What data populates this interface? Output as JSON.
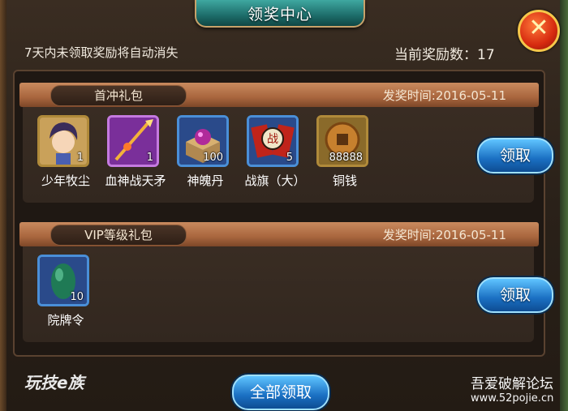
{
  "window": {
    "title": "领奖中心"
  },
  "header": {
    "notice": "7天内未领取奖励将自动消失",
    "reward_count": "当前奖励数：17"
  },
  "packs": [
    {
      "name": "首冲礼包",
      "time": "发奖时间:2016-05-11",
      "claim_label": "领取",
      "items": [
        {
          "name": "少年牧尘",
          "qty": "1",
          "icon": "hero-portrait-icon"
        },
        {
          "name": "血神战天矛",
          "qty": "1",
          "icon": "spear-icon"
        },
        {
          "name": "神魄丹",
          "qty": "100",
          "icon": "chest-orb-icon"
        },
        {
          "name": "战旗（大）",
          "qty": "5",
          "icon": "war-flag-icon"
        },
        {
          "name": "铜钱",
          "qty": "88888",
          "icon": "copper-coin-icon"
        }
      ]
    },
    {
      "name": "VIP等级礼包",
      "time": "发奖时间:2016-05-11",
      "claim_label": "领取",
      "items": [
        {
          "name": "院牌令",
          "qty": "10",
          "icon": "jade-token-icon"
        }
      ]
    }
  ],
  "footer": {
    "logo": "玩技e族",
    "claim_all_label": "全部领取",
    "watermark_name": "吾爱破解论坛",
    "watermark_url": "www.52pojie.cn"
  },
  "colors": {
    "accent_blue": "#1a6fc2",
    "bar_copper": "#a9663e",
    "close_red": "#d62a0f"
  }
}
